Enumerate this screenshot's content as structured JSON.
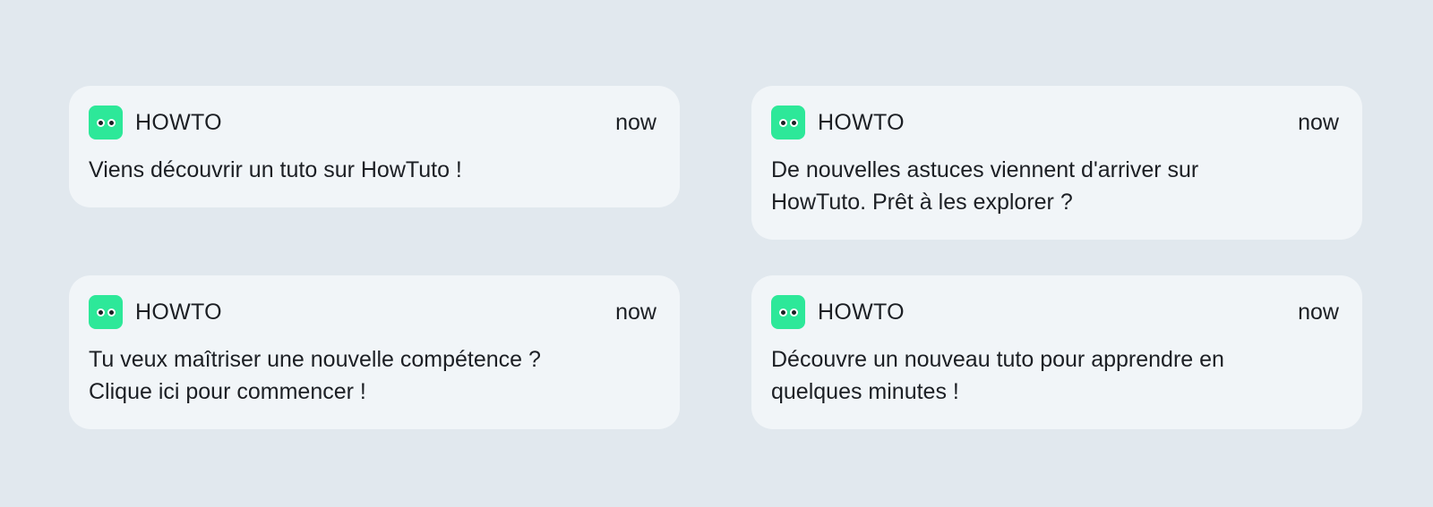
{
  "colors": {
    "background": "#e1e8ee",
    "card": "#f1f5f8",
    "app_icon": "#2de899",
    "text": "#1c1f24"
  },
  "notifications": [
    {
      "app_icon": "eyes-icon",
      "app_name": "HOWTO",
      "time": "now",
      "message_lines": [
        "Viens découvrir un tuto sur HowTuto !"
      ]
    },
    {
      "app_icon": "eyes-icon",
      "app_name": "HOWTO",
      "time": "now",
      "message_lines": [
        "De nouvelles astuces viennent d'arriver sur",
        "HowTuto. Prêt à les explorer ?"
      ]
    },
    {
      "app_icon": "eyes-icon",
      "app_name": "HOWTO",
      "time": "now",
      "message_lines": [
        "Tu veux maîtriser une nouvelle compétence ?",
        "Clique ici pour commencer !"
      ]
    },
    {
      "app_icon": "eyes-icon",
      "app_name": "HOWTO",
      "time": "now",
      "message_lines": [
        "Découvre un nouveau tuto pour apprendre en",
        "quelques minutes !"
      ]
    }
  ]
}
